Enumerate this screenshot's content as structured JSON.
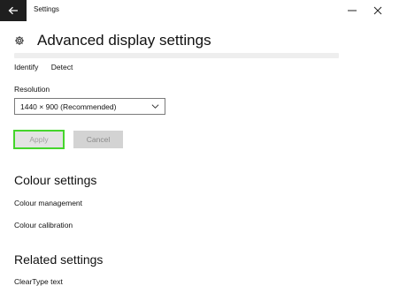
{
  "window": {
    "title": "Settings"
  },
  "header": {
    "page_title": "Advanced display settings"
  },
  "display": {
    "identify_label": "Identify",
    "detect_label": "Detect"
  },
  "resolution": {
    "label": "Resolution",
    "selected": "1440 × 900 (Recommended)"
  },
  "actions": {
    "apply_label": "Apply",
    "cancel_label": "Cancel",
    "highlight_color": "#45d52c"
  },
  "colour_settings": {
    "heading": "Colour settings",
    "items": [
      {
        "label": "Colour management"
      },
      {
        "label": "Colour calibration"
      }
    ]
  },
  "related_settings": {
    "heading": "Related settings",
    "items": [
      {
        "label": "ClearType text"
      }
    ]
  },
  "icons": {
    "back": "arrow-left-icon",
    "gear": "gear-icon",
    "minimize": "minimize-icon",
    "close": "close-icon",
    "dropdown": "chevron-down-icon"
  }
}
